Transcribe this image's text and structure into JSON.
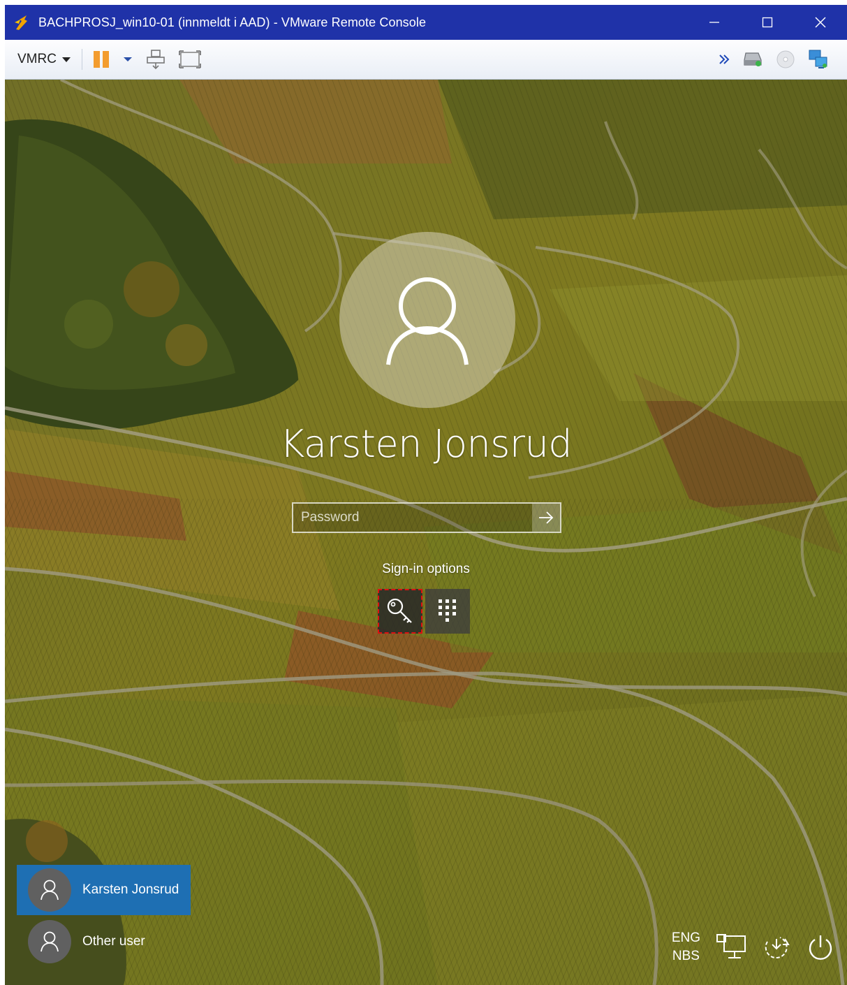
{
  "window": {
    "title": "BACHPROSJ_win10-01 (innmeldt i AAD) - VMware Remote Console",
    "icon": "vmware-logo-icon",
    "controls": [
      "minimize-icon",
      "maximize-icon",
      "close-icon"
    ]
  },
  "toolbar": {
    "menu_label": "VMRC",
    "left_icons": [
      "pause-icon",
      "dropdown-icon",
      "send-ctrl-alt-del-icon",
      "fit-window-icon"
    ],
    "right_icons": [
      "expand-icon",
      "hard-disk-icon",
      "cd-rom-icon",
      "network-icon"
    ]
  },
  "lockscreen": {
    "user_name": "Karsten Jonsrud",
    "password_placeholder": "Password",
    "password_value": "",
    "sign_in_options_label": "Sign-in options",
    "options": [
      {
        "icon": "key-icon",
        "selected": true
      },
      {
        "icon": "pin-keypad-icon",
        "selected": false
      }
    ],
    "users": [
      {
        "name": "Karsten Jonsrud",
        "selected": true
      },
      {
        "name": "Other user",
        "selected": false
      }
    ],
    "language": {
      "line1": "ENG",
      "line2": "NBS"
    },
    "tray_icons": [
      "network-icon",
      "ease-of-access-icon",
      "power-icon"
    ],
    "colors": {
      "selected_tile": "#1e6fb3",
      "titlebar": "#1f32a8",
      "focus_outline": "#dd1111"
    }
  }
}
